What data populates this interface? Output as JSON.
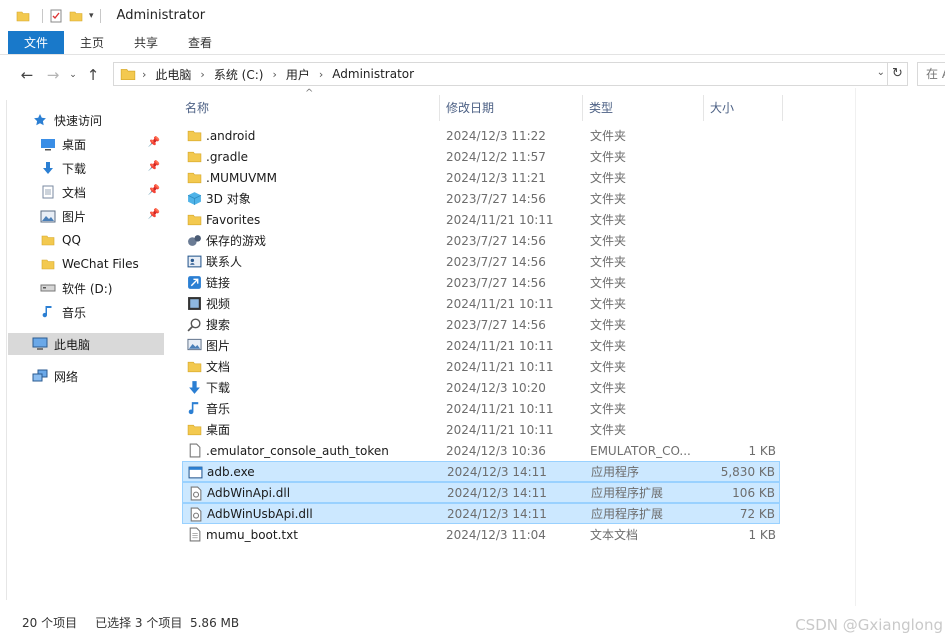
{
  "window": {
    "title": "Administrator"
  },
  "ribbon": {
    "tabs": [
      "文件",
      "主页",
      "共享",
      "查看"
    ]
  },
  "address": {
    "crumbs": [
      "此电脑",
      "系统 (C:)",
      "用户",
      "Administrator"
    ],
    "search_placeholder": "在 A"
  },
  "nav_pane": {
    "items": [
      {
        "label": "快速访问",
        "icon": "star-icon"
      },
      {
        "label": "桌面",
        "icon": "desktop-icon",
        "pinned": true
      },
      {
        "label": "下载",
        "icon": "download-icon",
        "pinned": true
      },
      {
        "label": "文档",
        "icon": "document-icon",
        "pinned": true
      },
      {
        "label": "图片",
        "icon": "picture-icon",
        "pinned": true
      },
      {
        "label": "QQ",
        "icon": "folder-icon"
      },
      {
        "label": "WeChat Files",
        "icon": "folder-icon"
      },
      {
        "label": "软件 (D:)",
        "icon": "drive-icon"
      },
      {
        "label": "音乐",
        "icon": "music-icon"
      },
      {
        "label": "此电脑",
        "icon": "computer-icon",
        "selected": true
      },
      {
        "label": "网络",
        "icon": "network-icon"
      }
    ]
  },
  "columns": {
    "name": "名称",
    "date": "修改日期",
    "type": "类型",
    "size": "大小"
  },
  "files": [
    {
      "name": ".android",
      "date": "2024/12/3 11:22",
      "type": "文件夹",
      "size": "",
      "icon": "folder-icon"
    },
    {
      "name": ".gradle",
      "date": "2024/12/2 11:57",
      "type": "文件夹",
      "size": "",
      "icon": "folder-icon"
    },
    {
      "name": ".MUMUVMM",
      "date": "2024/12/3 11:21",
      "type": "文件夹",
      "size": "",
      "icon": "folder-icon"
    },
    {
      "name": "3D 对象",
      "date": "2023/7/27 14:56",
      "type": "文件夹",
      "size": "",
      "icon": "3d-objects-icon"
    },
    {
      "name": "Favorites",
      "date": "2024/11/21 10:11",
      "type": "文件夹",
      "size": "",
      "icon": "folder-icon"
    },
    {
      "name": "保存的游戏",
      "date": "2023/7/27 14:56",
      "type": "文件夹",
      "size": "",
      "icon": "saved-games-icon"
    },
    {
      "name": "联系人",
      "date": "2023/7/27 14:56",
      "type": "文件夹",
      "size": "",
      "icon": "contacts-icon"
    },
    {
      "name": "链接",
      "date": "2023/7/27 14:56",
      "type": "文件夹",
      "size": "",
      "icon": "links-icon"
    },
    {
      "name": "视频",
      "date": "2024/11/21 10:11",
      "type": "文件夹",
      "size": "",
      "icon": "video-icon"
    },
    {
      "name": "搜索",
      "date": "2023/7/27 14:56",
      "type": "文件夹",
      "size": "",
      "icon": "search-icon"
    },
    {
      "name": "图片",
      "date": "2024/11/21 10:11",
      "type": "文件夹",
      "size": "",
      "icon": "picture-icon"
    },
    {
      "name": "文档",
      "date": "2024/11/21 10:11",
      "type": "文件夹",
      "size": "",
      "icon": "folder-icon"
    },
    {
      "name": "下载",
      "date": "2024/12/3 10:20",
      "type": "文件夹",
      "size": "",
      "icon": "download-icon"
    },
    {
      "name": "音乐",
      "date": "2024/11/21 10:11",
      "type": "文件夹",
      "size": "",
      "icon": "music-icon"
    },
    {
      "name": "桌面",
      "date": "2024/11/21 10:11",
      "type": "文件夹",
      "size": "",
      "icon": "folder-icon"
    },
    {
      "name": ".emulator_console_auth_token",
      "date": "2024/12/3 10:36",
      "type": "EMULATOR_CO...",
      "size": "1 KB",
      "icon": "file-icon"
    },
    {
      "name": "adb.exe",
      "date": "2024/12/3 14:11",
      "type": "应用程序",
      "size": "5,830 KB",
      "icon": "exe-icon",
      "selected": true
    },
    {
      "name": "AdbWinApi.dll",
      "date": "2024/12/3 14:11",
      "type": "应用程序扩展",
      "size": "106 KB",
      "icon": "dll-icon",
      "selected": true
    },
    {
      "name": "AdbWinUsbApi.dll",
      "date": "2024/12/3 14:11",
      "type": "应用程序扩展",
      "size": "72 KB",
      "icon": "dll-icon",
      "selected": true
    },
    {
      "name": "mumu_boot.txt",
      "date": "2024/12/3 11:04",
      "type": "文本文档",
      "size": "1 KB",
      "icon": "text-file-icon"
    }
  ],
  "status": {
    "count": "20 个项目",
    "selection": "已选择 3 个项目  5.86 MB"
  },
  "watermark": "CSDN @Gxianglong",
  "colors": {
    "accent": "#1979ca",
    "selection": "#cce8ff",
    "folder": "#f3c94f"
  }
}
